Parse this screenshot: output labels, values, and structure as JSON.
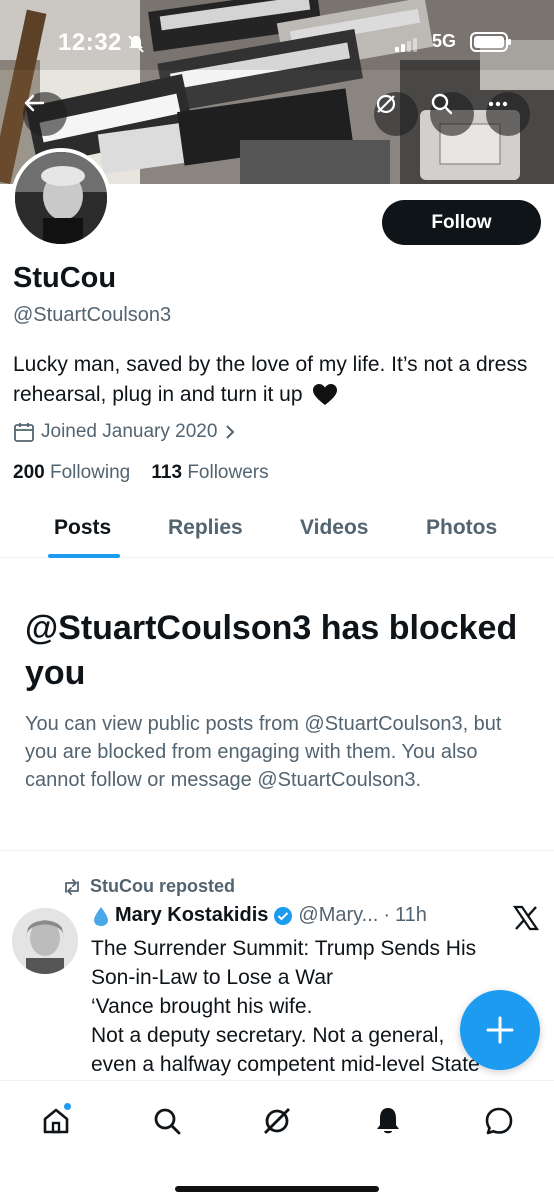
{
  "status_bar": {
    "time": "12:32",
    "network": "5G"
  },
  "colors": {
    "accent": "#1d9bf0",
    "text": "#0f1419",
    "muted": "#536471"
  },
  "header": {
    "back_icon": "back-arrow-icon",
    "grok_icon": "grok-icon",
    "search_icon": "search-icon",
    "more_icon": "more-icon"
  },
  "profile": {
    "name": "StuCou",
    "handle": "@StuartCoulson3",
    "bio": "Lucky man, saved by the love of my life. It’s not a dress rehearsal, plug in and turn it up",
    "joined": "Joined January 2020",
    "following_count": "200",
    "following_label": "Following",
    "followers_count": "113",
    "followers_label": "Followers",
    "follow_label": "Follow"
  },
  "tabs": [
    {
      "label": "Posts",
      "active": true
    },
    {
      "label": "Replies",
      "active": false
    },
    {
      "label": "Videos",
      "active": false
    },
    {
      "label": "Photos",
      "active": false
    }
  ],
  "blocked_notice": {
    "title": "@StuartCoulson3 has blocked you",
    "body": "You can view public posts from @StuartCoulson3, but you are blocked from engaging with them. You also cannot follow or message @StuartCoulson3."
  },
  "post": {
    "repost_label": "StuCou reposted",
    "author_name": "Mary Kostakidis",
    "author_handle": "@Mary...",
    "separator": "·",
    "time": "11h",
    "lines": [
      "The Surrender Summit: Trump Sends His",
      "Son-in-Law to Lose a War",
      "‘Vance brought his wife.",
      "Not a deputy secretary. Not a general,",
      "even a halfway competent mid-level State"
    ]
  },
  "bottom_nav": [
    {
      "icon": "home-icon"
    },
    {
      "icon": "search-icon"
    },
    {
      "icon": "grok-icon"
    },
    {
      "icon": "notifications-icon"
    },
    {
      "icon": "messages-icon"
    }
  ]
}
